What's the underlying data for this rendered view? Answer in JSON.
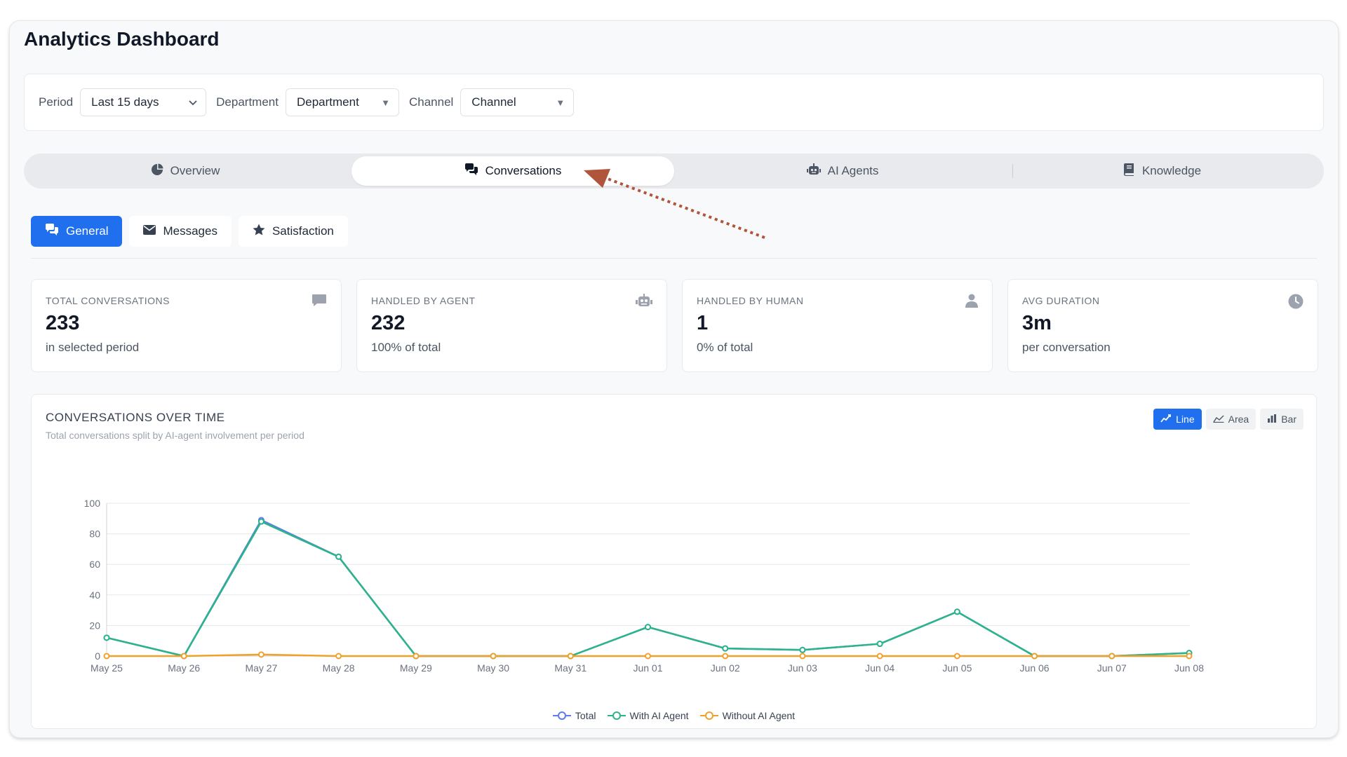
{
  "page": {
    "title": "Analytics Dashboard"
  },
  "filters": {
    "period_label": "Period",
    "period_value": "Last 15 days",
    "department_label": "Department",
    "department_value": "Department",
    "channel_label": "Channel",
    "channel_value": "Channel"
  },
  "tabs": [
    {
      "label": "Overview",
      "icon": "pie-chart-icon",
      "active": false
    },
    {
      "label": "Conversations",
      "icon": "chat-bubbles-icon",
      "active": true
    },
    {
      "label": "AI Agents",
      "icon": "robot-icon",
      "active": false
    },
    {
      "label": "Knowledge",
      "icon": "book-icon",
      "active": false
    }
  ],
  "subtabs": [
    {
      "label": "General",
      "icon": "chat-bubbles-icon",
      "active": true
    },
    {
      "label": "Messages",
      "icon": "envelope-icon",
      "active": false
    },
    {
      "label": "Satisfaction",
      "icon": "star-icon",
      "active": false
    }
  ],
  "cards": [
    {
      "label": "TOTAL CONVERSATIONS",
      "value": "233",
      "sub": "in selected period",
      "icon": "comment-icon"
    },
    {
      "label": "HANDLED BY AGENT",
      "value": "232",
      "sub": "100% of total",
      "icon": "robot-icon"
    },
    {
      "label": "HANDLED BY HUMAN",
      "value": "1",
      "sub": "0% of total",
      "icon": "user-icon"
    },
    {
      "label": "AVG DURATION",
      "value": "3m",
      "sub": "per conversation",
      "icon": "clock-icon"
    }
  ],
  "chart_panel": {
    "title": "CONVERSATIONS OVER TIME",
    "subtitle": "Total conversations split by AI-agent involvement per period",
    "chart_types": [
      {
        "label": "Line",
        "icon": "line-chart-icon",
        "active": true
      },
      {
        "label": "Area",
        "icon": "area-chart-icon",
        "active": false
      },
      {
        "label": "Bar",
        "icon": "bar-chart-icon",
        "active": false
      }
    ]
  },
  "colors": {
    "accent": "#1f6fef",
    "total": "#5b7ee8",
    "with_ai": "#2bb38a",
    "without_ai": "#f0a12b",
    "annotation_arrow": "#b0553b"
  },
  "chart_data": {
    "type": "line",
    "x": [
      "May 25",
      "May 26",
      "May 27",
      "May 28",
      "May 29",
      "May 30",
      "May 31",
      "Jun 01",
      "Jun 02",
      "Jun 03",
      "Jun 04",
      "Jun 05",
      "Jun 06",
      "Jun 07",
      "Jun 08"
    ],
    "series": [
      {
        "name": "Total",
        "color": "#5b7ee8",
        "values": [
          12,
          0,
          89,
          65,
          0,
          0,
          0,
          19,
          5,
          4,
          8,
          29,
          0,
          0,
          2
        ]
      },
      {
        "name": "With AI Agent",
        "color": "#2bb38a",
        "values": [
          12,
          0,
          88,
          65,
          0,
          0,
          0,
          19,
          5,
          4,
          8,
          29,
          0,
          0,
          2
        ]
      },
      {
        "name": "Without AI Agent",
        "color": "#f0a12b",
        "values": [
          0,
          0,
          1,
          0,
          0,
          0,
          0,
          0,
          0,
          0,
          0,
          0,
          0,
          0,
          0
        ]
      }
    ],
    "yticks": [
      0,
      20,
      40,
      60,
      80,
      100
    ],
    "ylim": [
      0,
      100
    ],
    "grid": true,
    "legend": "bottom-center"
  }
}
